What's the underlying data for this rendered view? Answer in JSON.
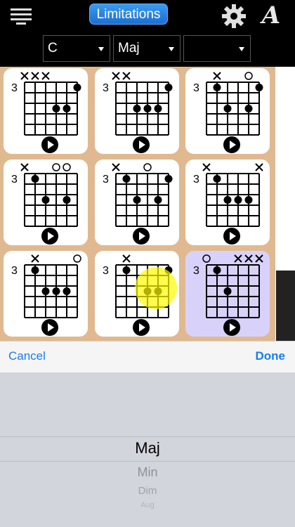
{
  "header": {
    "title": "Limitations",
    "left_icon": "hamburger-menu-icon",
    "gear_icon": "gear-icon",
    "font_icon": "font-style-icon",
    "font_icon_glyph": "A"
  },
  "selectors": {
    "root": "C",
    "quality": "Maj",
    "extra": ""
  },
  "chords": [
    {
      "fret": "3",
      "markers": [
        "x",
        "x",
        "x",
        "",
        "",
        ""
      ],
      "dots": [
        [
          5,
          1
        ],
        [
          3,
          3
        ],
        [
          4,
          3
        ]
      ]
    },
    {
      "fret": "3",
      "markers": [
        "x",
        "x",
        "",
        "",
        "",
        ""
      ],
      "dots": [
        [
          5,
          1
        ],
        [
          2,
          3
        ],
        [
          3,
          3
        ],
        [
          4,
          3
        ]
      ]
    },
    {
      "fret": "3",
      "markers": [
        "",
        "x",
        "",
        "",
        "o",
        ""
      ],
      "dots": [
        [
          1,
          1
        ],
        [
          5,
          1
        ],
        [
          2,
          3
        ],
        [
          4,
          3
        ]
      ]
    },
    {
      "fret": "3",
      "markers": [
        "x",
        "",
        "",
        "o",
        "o",
        ""
      ],
      "dots": [
        [
          1,
          1
        ],
        [
          2,
          3
        ],
        [
          4,
          3
        ]
      ]
    },
    {
      "fret": "3",
      "markers": [
        "x",
        "",
        "",
        "o",
        "",
        ""
      ],
      "dots": [
        [
          1,
          1
        ],
        [
          5,
          1
        ],
        [
          2,
          3
        ],
        [
          4,
          3
        ]
      ]
    },
    {
      "fret": "3",
      "markers": [
        "x",
        "",
        "",
        "",
        "",
        "x"
      ],
      "dots": [
        [
          1,
          1
        ],
        [
          2,
          3
        ],
        [
          3,
          3
        ],
        [
          4,
          3
        ]
      ]
    },
    {
      "fret": "3",
      "markers": [
        "",
        "x",
        "",
        "",
        "",
        "o"
      ],
      "dots": [
        [
          1,
          1
        ],
        [
          2,
          3
        ],
        [
          3,
          3
        ],
        [
          4,
          3
        ]
      ]
    },
    {
      "fret": "3",
      "markers": [
        "",
        "x",
        "",
        "",
        "",
        ""
      ],
      "dots": [
        [
          1,
          1
        ],
        [
          5,
          1
        ],
        [
          3,
          3
        ],
        [
          4,
          3
        ]
      ]
    },
    {
      "fret": "3",
      "markers": [
        "o",
        "",
        "",
        "x",
        "x",
        "x"
      ],
      "dots": [
        [
          1,
          1
        ],
        [
          2,
          3
        ]
      ]
    }
  ],
  "toolbar": {
    "cancel": "Cancel",
    "done": "Done"
  },
  "picker": {
    "options": [
      "Maj",
      "Min",
      "Dim",
      "Aug"
    ],
    "selected": "Maj"
  },
  "colors": {
    "grid_background": "#e0b990",
    "selected_card": "#d8d2fa",
    "accent": "#1a7cf0"
  }
}
